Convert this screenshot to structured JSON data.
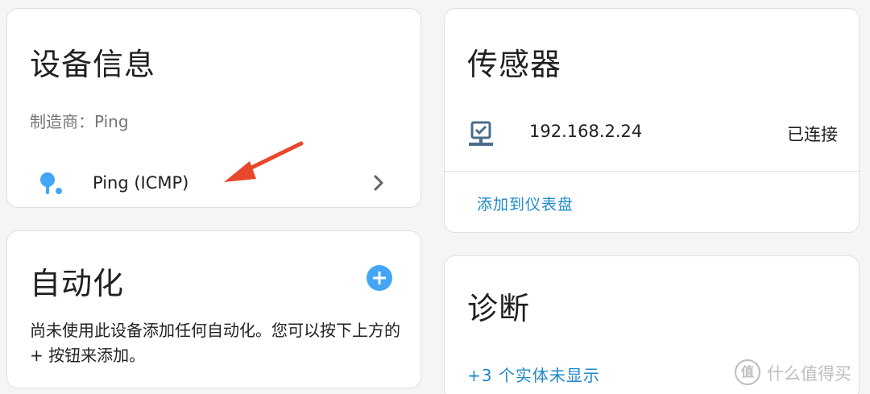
{
  "device_info": {
    "title": "设备信息",
    "manufacturer": "制造商：Ping",
    "integration_label": "Ping (ICMP)"
  },
  "automation": {
    "title": "自动化",
    "description": "尚未使用此设备添加任何自动化。您可以按下上方的 + 按钮来添加。"
  },
  "sensors": {
    "title": "传感器",
    "entity_name": "192.168.2.24",
    "entity_state": "已连接",
    "add_to_dashboard": "添加到仪表盘"
  },
  "diagnostics": {
    "title": "诊断",
    "hidden_entities": "+3 个实体未显示"
  },
  "watermark": {
    "text": "什么值得买",
    "logo": "值"
  },
  "colors": {
    "accent_blue": "#42a5f5",
    "link_blue": "#1e88c8",
    "annotation_red": "#e8472c",
    "network_icon": "#4a6d8c"
  },
  "icons": {
    "integration": "ping-pong-icon",
    "chevron": "chevron-right-icon",
    "sensor": "network-monitor-icon",
    "add": "plus-circle-icon"
  }
}
